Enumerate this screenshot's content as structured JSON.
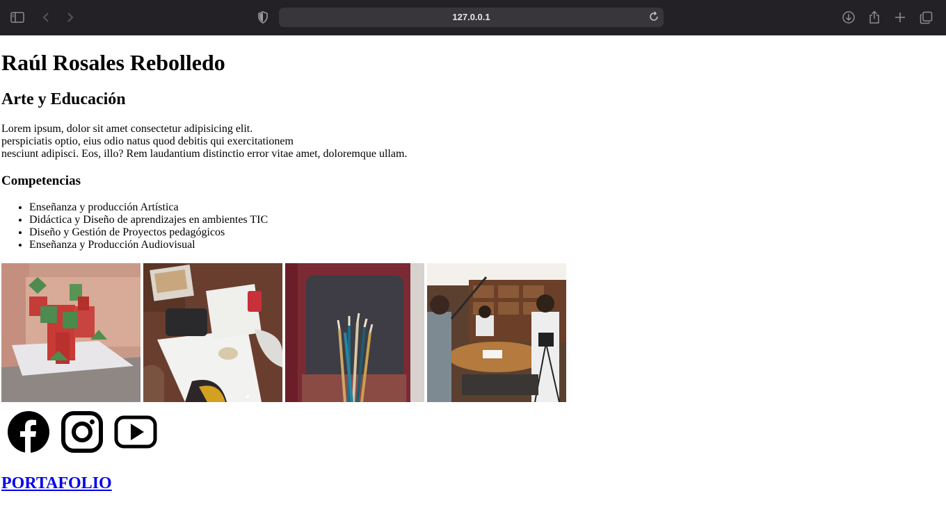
{
  "browser": {
    "url": "127.0.0.1",
    "icons": [
      "sidebar-icon",
      "back-icon",
      "forward-icon",
      "shield-icon",
      "reload-icon",
      "download-icon",
      "share-icon",
      "new-tab-icon",
      "tabs-overview-icon"
    ]
  },
  "page": {
    "title": "Raúl Rosales Rebolledo",
    "subtitle": "Arte y Educación",
    "intro_lines": [
      "Lorem ipsum, dolor sit amet consectetur adipisicing elit.",
      "perspiciatis optio, eius odio natus quod debitis qui exercitationem",
      "nesciunt adipisci. Eos, illo? Rem laudantium distinctio error vitae amet, doloremque ullam."
    ],
    "skills_heading": "Competencias",
    "skills": [
      "Enseñanza y producción Artística",
      "Didáctica y Diseño de aprendizajes en ambientes TIC",
      "Diseño y Gestión de Proyectos pedagógicos",
      "Enseñanza y Producción Audiovisual"
    ],
    "gallery": [
      "paper-sculpture-photo",
      "students-drawing-photo",
      "paintbrushes-photo",
      "film-crew-photo"
    ],
    "social": [
      "facebook-icon",
      "instagram-icon",
      "youtube-icon"
    ],
    "portfolio_link": "PORTAFOLIO"
  }
}
